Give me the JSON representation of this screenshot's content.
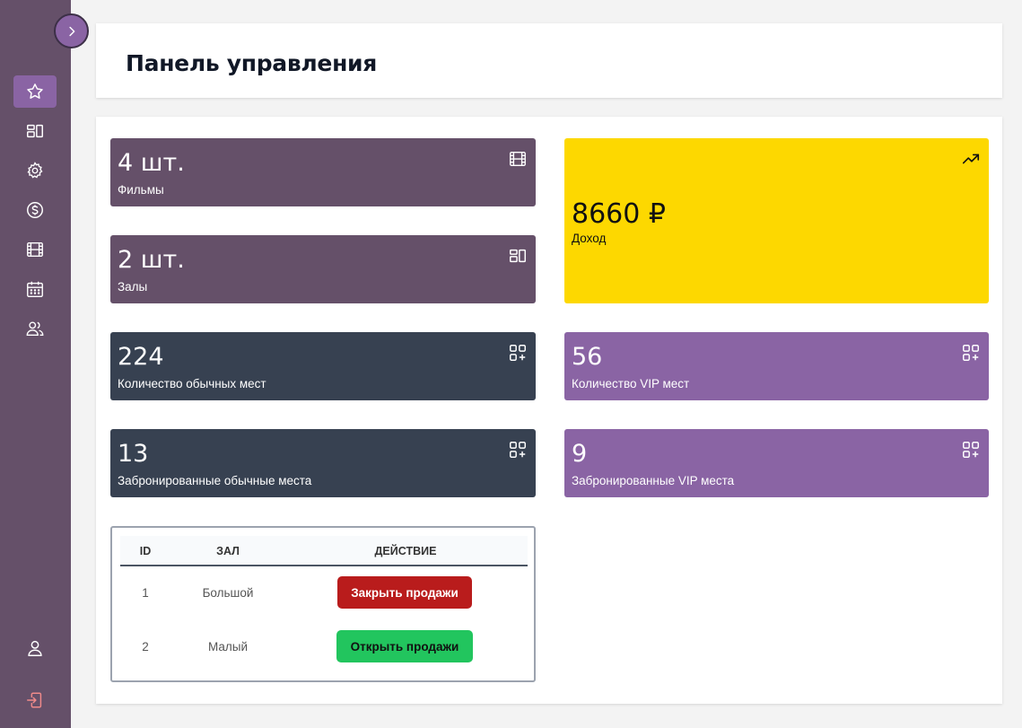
{
  "header": {
    "title": "Панель управления"
  },
  "sidebar": {
    "items": [
      {
        "icon": "star-icon",
        "active": true
      },
      {
        "icon": "layout-icon",
        "active": false
      },
      {
        "icon": "gear-icon",
        "active": false
      },
      {
        "icon": "dollar-icon",
        "active": false
      },
      {
        "icon": "film-icon",
        "active": false
      },
      {
        "icon": "calendar-icon",
        "active": false
      },
      {
        "icon": "users-icon",
        "active": false
      }
    ],
    "bottom": [
      {
        "icon": "user-icon"
      },
      {
        "icon": "logout-icon"
      }
    ]
  },
  "stats": {
    "films": {
      "value": "4 шт.",
      "label": "Фильмы",
      "icon": "film-icon"
    },
    "halls": {
      "value": "2 шт.",
      "label": "Залы",
      "icon": "layout-icon"
    },
    "revenue": {
      "value": "8660 ₽",
      "label": "Доход",
      "icon": "trending-up-icon"
    },
    "regular_seats": {
      "value": "224",
      "label": "Количество обычных мест",
      "icon": "grid-plus-icon"
    },
    "vip_seats": {
      "value": "56",
      "label": "Количество VIP мест",
      "icon": "grid-plus-icon"
    },
    "booked_regular": {
      "value": "13",
      "label": "Забронированные обычные места",
      "icon": "grid-plus-icon"
    },
    "booked_vip": {
      "value": "9",
      "label": "Забронированные VIP места",
      "icon": "grid-plus-icon"
    }
  },
  "halls_table": {
    "columns": [
      "ID",
      "ЗАЛ",
      "ДЕЙСТВИЕ"
    ],
    "rows": [
      {
        "id": "1",
        "name": "Большой",
        "action": "Закрыть продажи"
      },
      {
        "id": "2",
        "name": "Малый",
        "action": "Открыть продажи"
      }
    ]
  },
  "colors": {
    "sidebar": "#655069",
    "accent": "#8a64a4",
    "slate": "#374151",
    "yellow": "#fdd800",
    "danger": "#b91c1c",
    "success": "#22c55e"
  }
}
